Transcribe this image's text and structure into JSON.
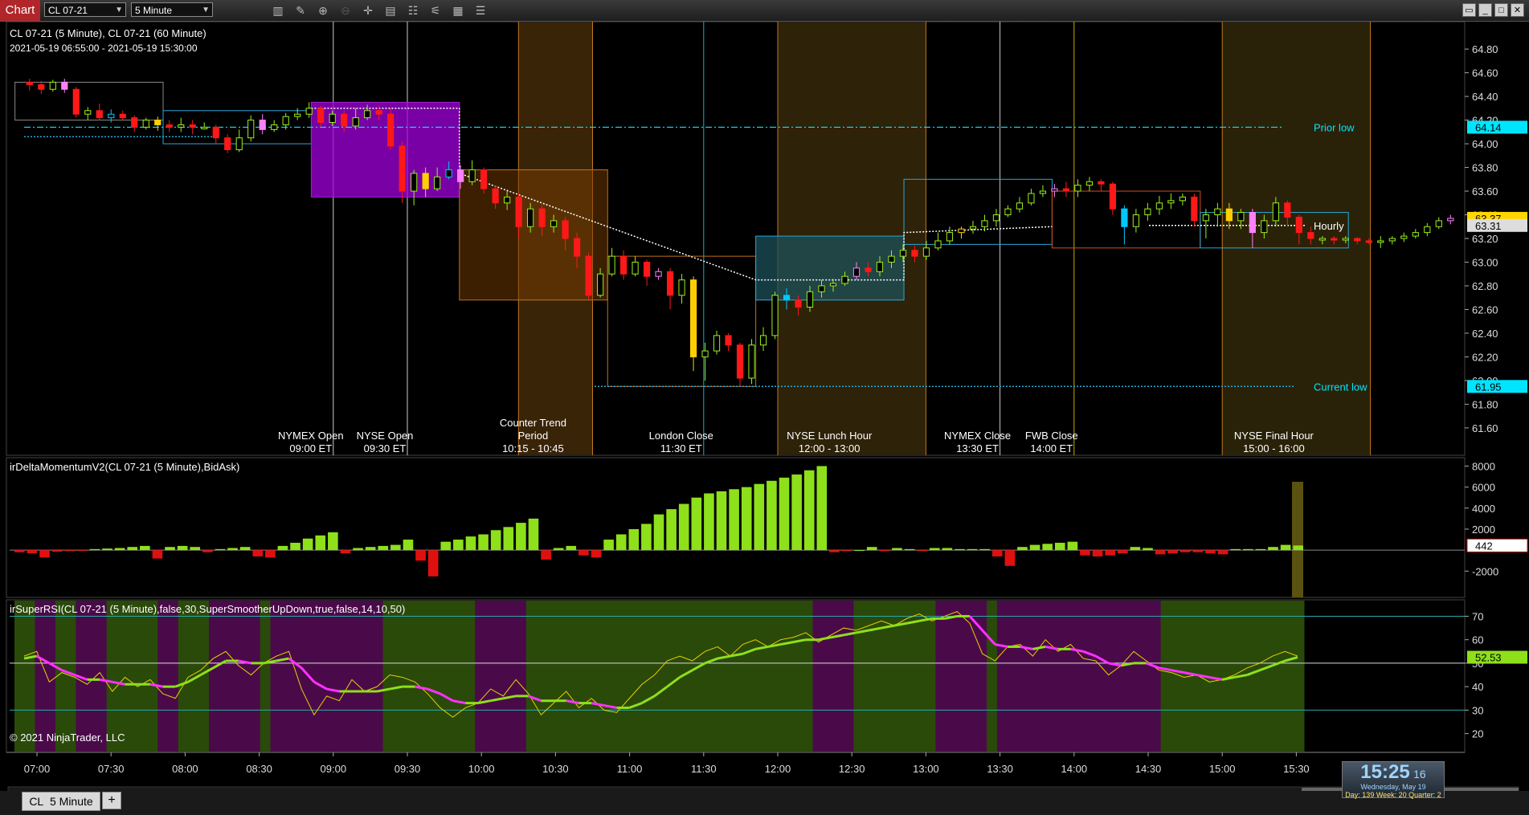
{
  "toolbar": {
    "tab_label": "Chart",
    "instrument": "CL 07-21",
    "interval": "5 Minute",
    "icons": [
      "bar-type-icon",
      "draw-tool-icon",
      "zoom-in-icon",
      "zoom-out-icon",
      "crosshair-icon",
      "data-box-icon",
      "properties-icon",
      "indicators-icon",
      "strategies-icon",
      "menu-icon"
    ],
    "window_buttons": [
      "restore-icon",
      "minimize-icon",
      "maximize-icon",
      "close-icon"
    ]
  },
  "header": {
    "series_label": "CL 07-21 (5 Minute), CL 07-21 (60 Minute)",
    "date_range": "2021-05-19 06:55:00 - 2021-05-19 15:30:00"
  },
  "price_axis": {
    "ticks": [
      "64.80",
      "64.60",
      "64.40",
      "64.20",
      "64.00",
      "63.80",
      "63.60",
      "63.40",
      "63.20",
      "63.00",
      "62.80",
      "62.60",
      "62.40",
      "62.20",
      "62.00",
      "61.80",
      "61.60"
    ],
    "tick_values": [
      64.8,
      64.6,
      64.4,
      64.2,
      64.0,
      63.8,
      63.6,
      63.4,
      63.2,
      63.0,
      62.8,
      62.6,
      62.4,
      62.2,
      62.0,
      61.8,
      61.6
    ],
    "range": [
      61.45,
      64.95
    ],
    "markers": [
      {
        "label": "64.14",
        "value": 64.14,
        "bg": "#00e5ff",
        "fg": "#000"
      },
      {
        "label": "63.37",
        "value": 63.37,
        "bg": "#ffd600",
        "fg": "#000"
      },
      {
        "label": "63.31",
        "value": 63.31,
        "bg": "#dddddd",
        "fg": "#000"
      },
      {
        "label": "61.95",
        "value": 61.95,
        "bg": "#00e5ff",
        "fg": "#000"
      }
    ],
    "line_labels": [
      {
        "text": "Prior low",
        "value": 64.14,
        "color": "#00e5ff"
      },
      {
        "text": "Hourly",
        "value": 63.31,
        "color": "#ffffff"
      },
      {
        "text": "Current low",
        "value": 61.95,
        "color": "#00e5ff"
      }
    ]
  },
  "sessions": [
    {
      "line1": "NYMEX Open",
      "line2": "09:00 ET",
      "time": "09:00",
      "color": "#ffffff"
    },
    {
      "line1": "NYSE Open",
      "line2": "09:30 ET",
      "time": "09:30",
      "color": "#ffffff"
    },
    {
      "line0": "Counter Trend",
      "line1": "Period",
      "line2": "10:15 - 10:45",
      "time": "10:30",
      "color": "#ff9f2e"
    },
    {
      "line1": "London Close",
      "line2": "11:30 ET",
      "time": "11:30",
      "color": "#00e5ff"
    },
    {
      "line1": "NYSE Lunch Hour",
      "line2": "12:00 - 13:00",
      "time": "12:30",
      "color": "#ff9f2e"
    },
    {
      "line1": "NYMEX Close",
      "line2": "13:30 ET",
      "time": "13:30",
      "color": "#ffffff"
    },
    {
      "line1": "FWB Close",
      "line2": "14:00 ET",
      "time": "14:00",
      "color": "#ffd600"
    },
    {
      "line1": "NYSE Final Hour",
      "line2": "15:00 - 16:00",
      "time": "15:30",
      "color": "#ff9f2e"
    }
  ],
  "delta_panel": {
    "title": "irDeltaMomentumV2(CL 07-21 (5 Minute),BidAsk)",
    "ticks": [
      "8000",
      "6000",
      "4000",
      "2000",
      "-2000"
    ],
    "tick_values": [
      8000,
      6000,
      4000,
      2000,
      -2000
    ],
    "range": [
      -4500,
      8800
    ],
    "last_value": "442",
    "values": [
      -200,
      -300,
      -700,
      -150,
      -100,
      -50,
      100,
      150,
      200,
      300,
      400,
      -800,
      300,
      400,
      300,
      -200,
      100,
      200,
      300,
      -600,
      -700,
      400,
      700,
      1100,
      1400,
      1700,
      -300,
      200,
      300,
      400,
      500,
      1000,
      -1000,
      -2500,
      800,
      1000,
      1300,
      1500,
      1900,
      2200,
      2600,
      3000,
      -900,
      200,
      400,
      -500,
      -700,
      1000,
      1500,
      2000,
      2500,
      3400,
      3900,
      4400,
      5000,
      5400,
      5600,
      5800,
      6000,
      6300,
      6600,
      6900,
      7200,
      7600,
      8000,
      -200,
      -100,
      0,
      300,
      -100,
      200,
      100,
      -100,
      200,
      200,
      100,
      100,
      100,
      -600,
      -1500,
      300,
      500,
      600,
      700,
      800,
      -500,
      -600,
      -500,
      -300,
      300,
      200,
      -400,
      -300,
      -200,
      -200,
      -300,
      -400,
      100,
      100,
      100,
      300,
      500,
      442
    ]
  },
  "rsi_panel": {
    "title": "irSuperRSI(CL 07-21 (5 Minute),false,30,SuperSmootherUpDown,true,false,14,10,50)",
    "ticks": [
      "70",
      "60",
      "50",
      "40",
      "30",
      "20"
    ],
    "tick_values": [
      70,
      60,
      50,
      40,
      30,
      20
    ],
    "range": [
      12,
      77
    ],
    "last_value": "52.53",
    "rsi_values": [
      53,
      55,
      42,
      46,
      44,
      41,
      46,
      38,
      44,
      40,
      43,
      37,
      35,
      44,
      47,
      52,
      55,
      49,
      45,
      50,
      53,
      55,
      39,
      28,
      36,
      34,
      43,
      38,
      40,
      45,
      44,
      42,
      37,
      31,
      27,
      31,
      33,
      39,
      36,
      43,
      37,
      28,
      33,
      38,
      31,
      35,
      30,
      29,
      35,
      41,
      45,
      51,
      53,
      51,
      55,
      57,
      53,
      58,
      60,
      57,
      60,
      61,
      63,
      59,
      62,
      65,
      64,
      66,
      68,
      66,
      69,
      71,
      68,
      70,
      72,
      67,
      54,
      51,
      57,
      58,
      53,
      60,
      55,
      58,
      52,
      51,
      45,
      49,
      55,
      51,
      47,
      46,
      44,
      45,
      42,
      43,
      45,
      48,
      50,
      53,
      55,
      53
    ],
    "smooth_values": [
      52,
      53,
      50,
      47,
      45,
      43,
      43,
      42,
      41,
      41,
      41,
      40,
      40,
      42,
      45,
      48,
      51,
      51,
      50,
      50,
      51,
      52,
      48,
      42,
      39,
      38,
      38,
      38,
      38,
      39,
      40,
      40,
      39,
      37,
      34,
      33,
      33,
      34,
      35,
      36,
      36,
      34,
      34,
      34,
      33,
      33,
      32,
      31,
      31,
      33,
      36,
      40,
      44,
      47,
      50,
      52,
      53,
      54,
      56,
      57,
      58,
      59,
      60,
      60,
      61,
      62,
      63,
      64,
      65,
      66,
      67,
      68,
      69,
      69,
      70,
      70,
      64,
      58,
      57,
      57,
      56,
      57,
      56,
      56,
      55,
      53,
      50,
      49,
      50,
      50,
      48,
      47,
      46,
      45,
      44,
      43,
      44,
      45,
      47,
      49,
      51,
      52.53
    ],
    "bands": [
      "g",
      "g",
      "m",
      "m",
      "g",
      "g",
      "m",
      "m",
      "m",
      "g",
      "g",
      "g",
      "g",
      "g",
      "m",
      "m",
      "g",
      "g",
      "g",
      "m",
      "m",
      "m",
      "m",
      "m",
      "g",
      "m",
      "m",
      "m",
      "m",
      "m",
      "m",
      "m",
      "m",
      "m",
      "m",
      "m",
      "g",
      "g",
      "g",
      "g",
      "g",
      "g",
      "g",
      "g",
      "g",
      "m",
      "m",
      "m",
      "m",
      "m",
      "g",
      "g",
      "g",
      "g",
      "g",
      "g",
      "g",
      "g",
      "g",
      "g",
      "g",
      "g",
      "g",
      "g",
      "g",
      "g",
      "g",
      "g",
      "g",
      "g",
      "g",
      "g",
      "g",
      "g",
      "g",
      "g",
      "g",
      "g",
      "m",
      "m",
      "m",
      "m",
      "g",
      "g",
      "g",
      "g",
      "g",
      "g",
      "g",
      "g",
      "m",
      "m",
      "m",
      "m",
      "m",
      "g",
      "m",
      "m",
      "m",
      "m",
      "m",
      "m",
      "m",
      "m",
      "m",
      "m",
      "m",
      "m",
      "m",
      "m",
      "m",
      "m",
      "g",
      "g",
      "g",
      "g",
      "g",
      "g",
      "g",
      "g",
      "g",
      "g",
      "g",
      "g",
      "g",
      "g"
    ]
  },
  "time_axis": {
    "labels": [
      "07:00",
      "07:30",
      "08:00",
      "08:30",
      "09:00",
      "09:30",
      "10:00",
      "10:30",
      "11:00",
      "11:30",
      "12:00",
      "12:30",
      "13:00",
      "13:30",
      "14:00",
      "14:30",
      "15:00",
      "15:30"
    ]
  },
  "copyright": "© 2021 NinjaTrader, LLC",
  "candles": [
    [
      64.52,
      64.5,
      64.55,
      64.45
    ],
    [
      64.5,
      64.46,
      64.53,
      64.42
    ],
    [
      64.46,
      64.52,
      64.54,
      64.44
    ],
    [
      64.52,
      64.46,
      64.55,
      64.43
    ],
    [
      64.46,
      64.25,
      64.48,
      64.22
    ],
    [
      64.25,
      64.28,
      64.31,
      64.2
    ],
    [
      64.28,
      64.22,
      64.34,
      64.2
    ],
    [
      64.22,
      64.25,
      64.29,
      64.18
    ],
    [
      64.25,
      64.22,
      64.28,
      64.2
    ],
    [
      64.22,
      64.14,
      64.24,
      64.1
    ],
    [
      64.14,
      64.2,
      64.22,
      64.12
    ],
    [
      64.2,
      64.16,
      64.23,
      64.11
    ],
    [
      64.16,
      64.14,
      64.2,
      64.1
    ],
    [
      64.14,
      64.16,
      64.22,
      64.1
    ],
    [
      64.16,
      64.14,
      64.2,
      64.08
    ],
    [
      64.14,
      64.14,
      64.18,
      64.12
    ],
    [
      64.14,
      64.05,
      64.16,
      64.0
    ],
    [
      64.05,
      63.95,
      64.08,
      63.92
    ],
    [
      63.95,
      64.05,
      64.12,
      63.93
    ],
    [
      64.05,
      64.2,
      64.24,
      64.02
    ],
    [
      64.2,
      64.12,
      64.25,
      64.08
    ],
    [
      64.12,
      64.16,
      64.2,
      64.1
    ],
    [
      64.16,
      64.23,
      64.26,
      64.12
    ],
    [
      64.23,
      64.25,
      64.3,
      64.2
    ],
    [
      64.25,
      64.3,
      64.35,
      64.22
    ],
    [
      64.3,
      64.18,
      64.32,
      64.14
    ],
    [
      64.18,
      64.25,
      64.28,
      64.15
    ],
    [
      64.25,
      64.15,
      64.28,
      64.1
    ],
    [
      64.15,
      64.22,
      64.3,
      64.12
    ],
    [
      64.22,
      64.28,
      64.33,
      64.2
    ],
    [
      64.28,
      64.25,
      64.32,
      64.2
    ],
    [
      64.25,
      63.98,
      64.3,
      63.95
    ],
    [
      63.98,
      63.6,
      64.02,
      63.5
    ],
    [
      63.6,
      63.75,
      63.78,
      63.48
    ],
    [
      63.75,
      63.62,
      63.8,
      63.55
    ],
    [
      63.62,
      63.72,
      63.8,
      63.6
    ],
    [
      63.72,
      63.78,
      63.85,
      63.7
    ],
    [
      63.78,
      63.68,
      63.82,
      63.62
    ],
    [
      63.68,
      63.78,
      63.86,
      63.65
    ],
    [
      63.78,
      63.62,
      63.8,
      63.58
    ],
    [
      63.62,
      63.5,
      63.65,
      63.45
    ],
    [
      63.5,
      63.55,
      63.6,
      63.44
    ],
    [
      63.55,
      63.3,
      63.58,
      63.2
    ],
    [
      63.3,
      63.45,
      63.5,
      63.25
    ],
    [
      63.45,
      63.3,
      63.48,
      63.22
    ],
    [
      63.3,
      63.35,
      63.4,
      63.25
    ],
    [
      63.35,
      63.2,
      63.38,
      63.1
    ],
    [
      63.2,
      63.05,
      63.25,
      62.95
    ],
    [
      63.05,
      62.72,
      63.08,
      62.68
    ],
    [
      62.72,
      62.9,
      62.95,
      62.7
    ],
    [
      62.9,
      63.05,
      63.12,
      62.88
    ],
    [
      63.05,
      62.9,
      63.1,
      62.85
    ],
    [
      62.9,
      63.0,
      63.05,
      62.88
    ],
    [
      63.0,
      62.88,
      63.02,
      62.8
    ],
    [
      62.88,
      62.92,
      62.95,
      62.85
    ],
    [
      62.92,
      62.72,
      62.95,
      62.6
    ],
    [
      62.72,
      62.85,
      62.9,
      62.65
    ],
    [
      62.85,
      62.2,
      62.88,
      62.08
    ],
    [
      62.2,
      62.25,
      62.32,
      62.0
    ],
    [
      62.25,
      62.38,
      62.42,
      62.22
    ],
    [
      62.38,
      62.3,
      62.4,
      62.25
    ],
    [
      62.3,
      62.02,
      62.32,
      61.95
    ],
    [
      62.02,
      62.3,
      62.35,
      61.97
    ],
    [
      62.3,
      62.38,
      62.45,
      62.25
    ],
    [
      62.38,
      62.72,
      62.75,
      62.35
    ],
    [
      62.72,
      62.68,
      62.78,
      62.6
    ],
    [
      62.68,
      62.62,
      62.72,
      62.55
    ],
    [
      62.62,
      62.75,
      62.8,
      62.58
    ],
    [
      62.75,
      62.8,
      62.85,
      62.7
    ],
    [
      62.8,
      62.82,
      62.86,
      62.75
    ],
    [
      62.82,
      62.88,
      62.92,
      62.8
    ],
    [
      62.88,
      62.95,
      63.0,
      62.85
    ],
    [
      62.95,
      62.92,
      63.0,
      62.88
    ],
    [
      62.92,
      63.0,
      63.05,
      62.88
    ],
    [
      63.0,
      63.05,
      63.1,
      62.95
    ],
    [
      63.05,
      63.1,
      63.15,
      63.0
    ],
    [
      63.1,
      63.05,
      63.14,
      63.0
    ],
    [
      63.05,
      63.12,
      63.18,
      63.02
    ],
    [
      63.12,
      63.18,
      63.25,
      63.1
    ],
    [
      63.18,
      63.25,
      63.3,
      63.15
    ],
    [
      63.25,
      63.28,
      63.3,
      63.2
    ],
    [
      63.28,
      63.3,
      63.35,
      63.24
    ],
    [
      63.3,
      63.35,
      63.4,
      63.26
    ],
    [
      63.35,
      63.4,
      63.45,
      63.3
    ],
    [
      63.4,
      63.45,
      63.48,
      63.38
    ],
    [
      63.45,
      63.5,
      63.55,
      63.42
    ],
    [
      63.5,
      63.58,
      63.62,
      63.48
    ],
    [
      63.58,
      63.6,
      63.65,
      63.55
    ],
    [
      63.6,
      63.62,
      63.66,
      63.55
    ],
    [
      63.62,
      63.6,
      63.68,
      63.55
    ],
    [
      63.6,
      63.65,
      63.7,
      63.55
    ],
    [
      63.65,
      63.68,
      63.72,
      63.6
    ],
    [
      63.68,
      63.66,
      63.7,
      63.6
    ],
    [
      63.66,
      63.45,
      63.68,
      63.4
    ],
    [
      63.45,
      63.3,
      63.48,
      63.15
    ],
    [
      63.3,
      63.4,
      63.45,
      63.25
    ],
    [
      63.4,
      63.45,
      63.5,
      63.35
    ],
    [
      63.45,
      63.5,
      63.56,
      63.4
    ],
    [
      63.5,
      63.52,
      63.58,
      63.45
    ],
    [
      63.52,
      63.55,
      63.58,
      63.48
    ],
    [
      63.55,
      63.35,
      63.58,
      63.3
    ],
    [
      63.35,
      63.4,
      63.45,
      63.2
    ],
    [
      63.4,
      63.45,
      63.5,
      63.3
    ],
    [
      63.45,
      63.35,
      63.5,
      63.28
    ],
    [
      63.35,
      63.42,
      63.45,
      63.28
    ],
    [
      63.42,
      63.25,
      63.45,
      63.12
    ],
    [
      63.25,
      63.35,
      63.4,
      63.2
    ],
    [
      63.35,
      63.5,
      63.55,
      63.3
    ],
    [
      63.5,
      63.38,
      63.52,
      63.3
    ],
    [
      63.38,
      63.25,
      63.4,
      63.15
    ],
    [
      63.25,
      63.2,
      63.3,
      63.15
    ],
    [
      63.2,
      63.2,
      63.22,
      63.15
    ],
    [
      63.2,
      63.19,
      63.22,
      63.15
    ],
    [
      63.19,
      63.2,
      63.22,
      63.16
    ],
    [
      63.2,
      63.18,
      63.21,
      63.15
    ],
    [
      63.18,
      63.17,
      63.2,
      63.15
    ],
    [
      63.17,
      63.18,
      63.22,
      63.12
    ],
    [
      63.18,
      63.2,
      63.22,
      63.15
    ],
    [
      63.2,
      63.22,
      63.25,
      63.17
    ],
    [
      63.22,
      63.25,
      63.28,
      63.2
    ],
    [
      63.25,
      63.3,
      63.33,
      63.22
    ],
    [
      63.3,
      63.35,
      63.38,
      63.28
    ],
    [
      63.35,
      63.37,
      63.4,
      63.32
    ]
  ]
}
